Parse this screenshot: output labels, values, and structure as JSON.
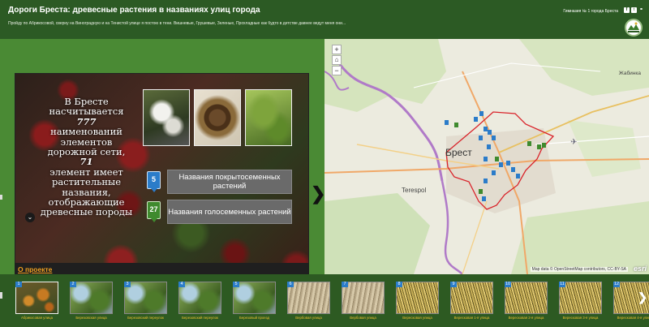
{
  "header": {
    "title": "Дороги Бреста: древесные растения в названиях улиц города",
    "subtitle": "Пройду по Абрикосовой, сверну на Виноградную и на Тенистой улице я постою в тени. Вишневые, Грушевые, Зеленые, Прохладные как будто в детстве давнее ведут меня они...",
    "org_name": "Гимназия № 1 города Бреста",
    "share_icons": [
      "facebook-icon",
      "twitter-icon",
      "link-icon"
    ],
    "fb_glyph": "f",
    "tw_glyph": "t",
    "link_glyph": "⚭"
  },
  "story": {
    "line_1": "В Бресте",
    "line_2": "насчитывается",
    "total": "777",
    "line_3": "наименований элементов дорожной сети,",
    "plant_count": "71",
    "line_4": "элемент имеет растительные названия, отображающие древесные породы",
    "expand_glyph": "⌄",
    "legend": [
      {
        "count": "5",
        "label": "Названия покрытосеменных растений",
        "color": "#2b7cc9"
      },
      {
        "count": "27",
        "label": "Названия голосеменных растений",
        "color": "#3f8a2e"
      }
    ],
    "about_link": "О проекте",
    "next_glyph": "❯"
  },
  "map": {
    "zoom_in": "+",
    "home": "⌂",
    "zoom_out": "−",
    "city_label": "Брест",
    "terespol_label": "Terespol",
    "zhabinka_label": "Жабинка",
    "attribution": "Map data © OpenStreetMap contributors, CC-BY-SA",
    "esri": "esri",
    "accent": "#d9232a"
  },
  "carousel": {
    "next_glyph": "❯",
    "items": [
      {
        "num": "1",
        "label": "Абрикосовая улица",
        "texture": "apricot"
      },
      {
        "num": "2",
        "label": "Березовская улица",
        "texture": "cherry"
      },
      {
        "num": "3",
        "label": "Березовский переулок",
        "texture": "cherry"
      },
      {
        "num": "4",
        "label": "Березовский переулок",
        "texture": "cherry"
      },
      {
        "num": "5",
        "label": "Березовый проезд",
        "texture": "cherry"
      },
      {
        "num": "6",
        "label": "Вербовая улица",
        "texture": "willow"
      },
      {
        "num": "7",
        "label": "Вербовая улица",
        "texture": "willow"
      },
      {
        "num": "8",
        "label": "Вересковая улица",
        "texture": "birch"
      },
      {
        "num": "9",
        "label": "Вересковая 1-я улица",
        "texture": "birch"
      },
      {
        "num": "10",
        "label": "Вересковая 2-я улица",
        "texture": "birch"
      },
      {
        "num": "11",
        "label": "Вересковая 3-я улица",
        "texture": "birch"
      },
      {
        "num": "12",
        "label": "Вересковая 4-я улица",
        "texture": "birch"
      }
    ]
  }
}
